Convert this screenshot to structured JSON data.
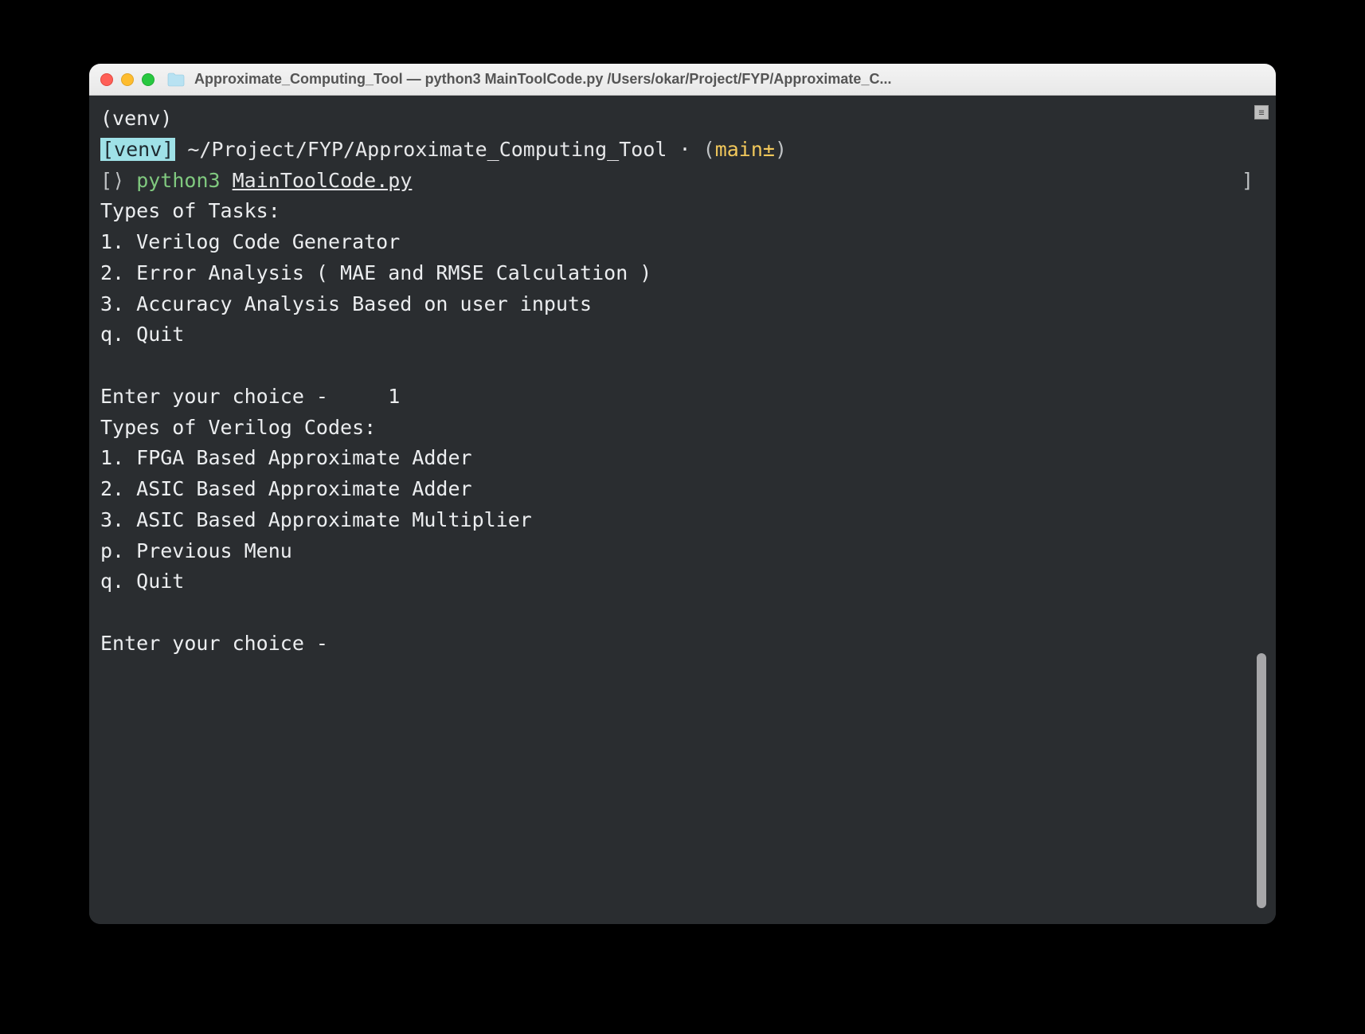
{
  "window": {
    "title": "Approximate_Computing_Tool — python3 MainToolCode.py  /Users/okar/Project/FYP/Approximate_C..."
  },
  "prompt": {
    "venv_top": "(venv)",
    "venv_hl": "[venv]",
    "path": "~/Project/FYP/Approximate_Computing_Tool",
    "dot": "·",
    "branch_paren_open": "(",
    "branch": "main±",
    "branch_paren_close": ")",
    "prompt_open": "[",
    "prompt_symbol": "⟩",
    "cmd": "python3",
    "cmd_arg": "MainToolCode.py",
    "prompt_close": "]"
  },
  "output": {
    "tasks_header": "Types of Tasks:",
    "tasks": [
      "1. Verilog Code Generator",
      "2. Error Analysis ( MAE and RMSE Calculation )",
      "3. Accuracy Analysis Based on user inputs",
      "q. Quit"
    ],
    "choice1_prompt": "Enter your choice -     1",
    "vcodes_header": "Types of Verilog Codes:",
    "vcodes": [
      "1. FPGA Based Approximate Adder",
      "2. ASIC Based Approximate Adder",
      "3. ASIC Based Approximate Multiplier",
      "p. Previous Menu",
      "q. Quit"
    ],
    "choice2_prompt": "Enter your choice - "
  }
}
